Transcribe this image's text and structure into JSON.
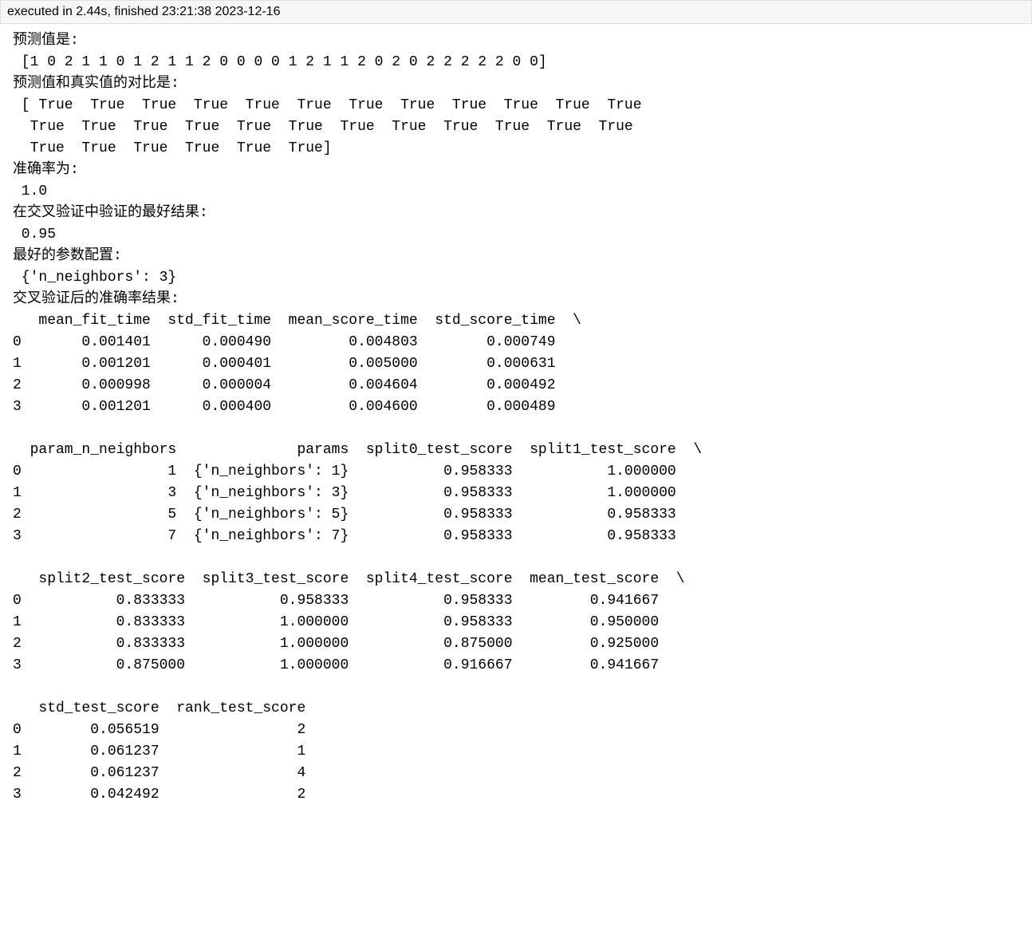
{
  "execution_status": "executed in 2.44s, finished 23:21:38 2023-12-16",
  "output": {
    "line1": "预测值是:",
    "line2": " [1 0 2 1 1 0 1 2 1 1 2 0 0 0 0 1 2 1 1 2 0 2 0 2 2 2 2 2 0 0]",
    "line3": "预测值和真实值的对比是:",
    "line4": " [ True  True  True  True  True  True  True  True  True  True  True  True",
    "line5": "  True  True  True  True  True  True  True  True  True  True  True  True",
    "line6": "  True  True  True  True  True  True]",
    "line7": "准确率为:",
    "line8": " 1.0",
    "line9": "在交叉验证中验证的最好结果:",
    "line10": " 0.95",
    "line11": "最好的参数配置:",
    "line12": " {'n_neighbors': 3}",
    "line13": "交叉验证后的准确率结果:",
    "line14": "   mean_fit_time  std_fit_time  mean_score_time  std_score_time  \\",
    "line15": "0       0.001401      0.000490         0.004803        0.000749   ",
    "line16": "1       0.001201      0.000401         0.005000        0.000631   ",
    "line17": "2       0.000998      0.000004         0.004604        0.000492   ",
    "line18": "3       0.001201      0.000400         0.004600        0.000489   ",
    "line19": "",
    "line20": "  param_n_neighbors              params  split0_test_score  split1_test_score  \\",
    "line21": "0                 1  {'n_neighbors': 1}           0.958333           1.000000   ",
    "line22": "1                 3  {'n_neighbors': 3}           0.958333           1.000000   ",
    "line23": "2                 5  {'n_neighbors': 5}           0.958333           0.958333   ",
    "line24": "3                 7  {'n_neighbors': 7}           0.958333           0.958333   ",
    "line25": "",
    "line26": "   split2_test_score  split3_test_score  split4_test_score  mean_test_score  \\",
    "line27": "0           0.833333           0.958333           0.958333         0.941667   ",
    "line28": "1           0.833333           1.000000           0.958333         0.950000   ",
    "line29": "2           0.833333           1.000000           0.875000         0.925000   ",
    "line30": "3           0.875000           1.000000           0.916667         0.941667   ",
    "line31": "",
    "line32": "   std_test_score  rank_test_score  ",
    "line33": "0        0.056519                2  ",
    "line34": "1        0.061237                1  ",
    "line35": "2        0.061237                4  ",
    "line36": "3        0.042492                2  "
  }
}
